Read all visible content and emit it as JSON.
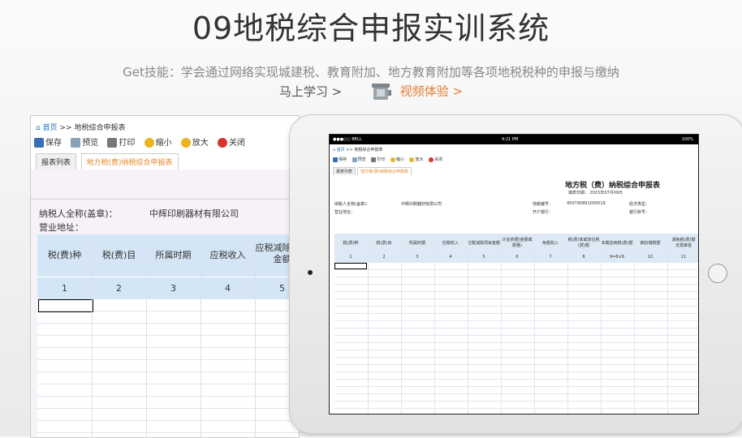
{
  "hero": {
    "title": "09地税综合申报实训系统",
    "subtitle": "Get技能：学会通过网络实现城建税、教育附加、地方教育附加等各项地税税种的申报与缴纳",
    "learn_link": "马上学习 >",
    "video_link": "视频体验 >"
  },
  "app": {
    "breadcrumb_home": "首页",
    "breadcrumb_sep": ">>",
    "breadcrumb_page": "地税综合申报表",
    "toolbar": {
      "save": "保存",
      "preview": "预览",
      "print": "打印",
      "zoom_out": "缩小",
      "zoom_in": "放大",
      "close": "关闭"
    },
    "tabs": [
      "报表列表",
      "地方税(费)纳税综合申报表"
    ],
    "form": {
      "title": "地方税（费）纳税综合申报表",
      "fill_date_label": "填表日期：",
      "fill_date": "2015年07月09日",
      "taxpayer_label": "纳税人全称(盖章)：",
      "taxpayer_value": "中辉印刷器材有限公司",
      "address_label": "营业地址：",
      "taxcode_label": "地税编号：",
      "taxcode_value": "450790891000019",
      "bank_label": "开户银行：",
      "econtype_label": "经济类型：",
      "account_label": "银行账号：",
      "columns": [
        "税(费)种",
        "税(费)目",
        "所属时期",
        "应税收入",
        "应税减除项目金额",
        "计征依据(金额或数量)",
        "免税收入",
        "税(费)率或单位税(费)额",
        "本期应纳税(费)额",
        "被扣缴税额",
        "减免税(费)额"
      ],
      "column_numbers": [
        "1",
        "2",
        "3",
        "4",
        "5",
        "6",
        "7",
        "8",
        "9=6×8",
        "10",
        "11"
      ],
      "big_col_partial": "应税减除项目金额",
      "extra_header": "无需审批"
    },
    "status_bar": {
      "carrier": "●●●○○ BELL",
      "time": "4:21 PM",
      "battery": "100%"
    }
  }
}
